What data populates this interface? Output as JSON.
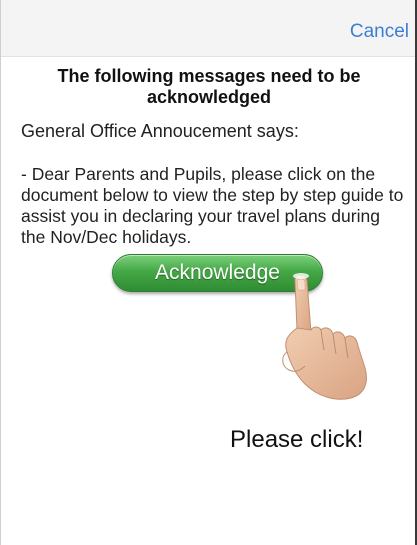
{
  "header": {
    "cancel_label": "Cancel"
  },
  "dialog": {
    "title": "The following messages need to be acknowledged",
    "sender_line": "General Office Annoucement says:",
    "message": "- Dear Parents and Pupils, please click on the document below to view the step by step guide to assist you in declaring your travel plans during the Nov/Dec holidays.",
    "acknowledge_label": "Acknowledge"
  },
  "annotation": {
    "callout": "Please click!",
    "pointer_icon": "pointing-hand-icon"
  },
  "colors": {
    "link_blue": "#3b7fd4",
    "button_green": "#45a846",
    "header_bg": "#f4f4f4"
  }
}
